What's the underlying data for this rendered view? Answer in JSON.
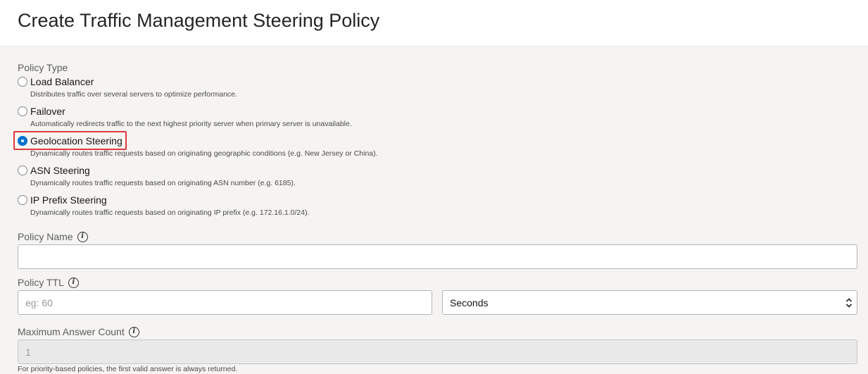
{
  "header": {
    "title": "Create Traffic Management Steering Policy"
  },
  "policy_type": {
    "label": "Policy Type",
    "options": [
      {
        "label": "Load Balancer",
        "description": "Distributes traffic over several servers to optimize performance.",
        "checked": false
      },
      {
        "label": "Failover",
        "description": "Automatically redirects traffic to the next highest priority server when primary server is unavailable.",
        "checked": false
      },
      {
        "label": "Geolocation Steering",
        "description": "Dynamically routes traffic requests based on originating geographic conditions (e.g. New Jersey or China).",
        "checked": true
      },
      {
        "label": "ASN Steering",
        "description": "Dynamically routes traffic requests based on originating ASN number (e.g. 6185).",
        "checked": false
      },
      {
        "label": "IP Prefix Steering",
        "description": "Dynamically routes traffic requests based on originating IP prefix (e.g. 172.16.1.0/24).",
        "checked": false
      }
    ]
  },
  "policy_name": {
    "label": "Policy Name",
    "value": "",
    "info_icon": "info-icon"
  },
  "policy_ttl": {
    "label": "Policy TTL",
    "placeholder": "eg: 60",
    "unit_selected": "Seconds",
    "info_icon": "info-icon"
  },
  "max_answer_count": {
    "label": "Maximum Answer Count",
    "value": "1",
    "hint": "For priority-based policies, the first valid answer is always returned.",
    "info_icon": "info-icon"
  },
  "colors": {
    "accent": "#0572ce",
    "highlight": "#e0393e"
  }
}
